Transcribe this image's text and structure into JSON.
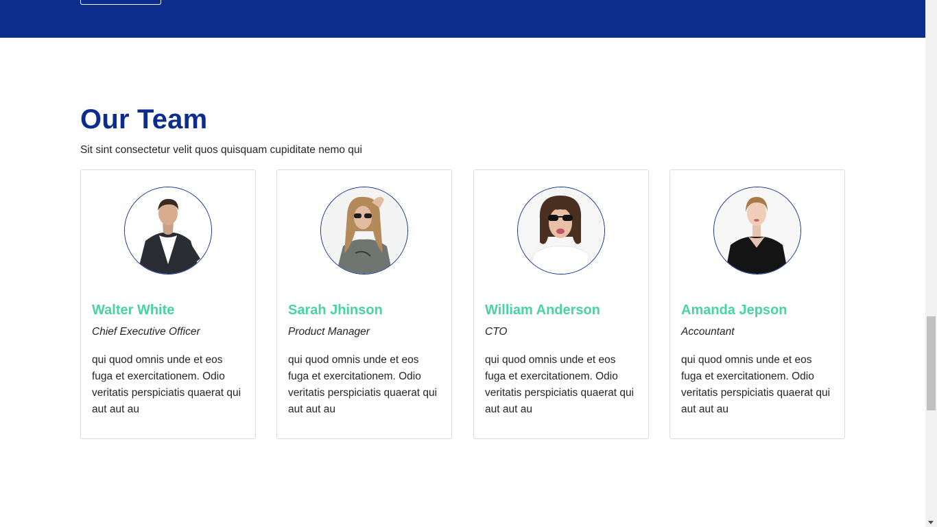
{
  "colors": {
    "brand_blue": "#0c2d8c",
    "name_green": "#47d4a0",
    "card_border": "#dcdcdc"
  },
  "section": {
    "title": "Our Team",
    "subtitle": "Sit sint consectetur velit quos quisquam cupiditate nemo qui"
  },
  "team": [
    {
      "name": "Walter White",
      "role": "Chief Executive Officer",
      "bio": "qui quod omnis unde et eos fuga et exercitationem. Odio veritatis perspiciatis quaerat qui aut aut au",
      "photo_icon": "man-in-suit-photo"
    },
    {
      "name": "Sarah Jhinson",
      "role": "Product Manager",
      "bio": "qui quod omnis unde et eos fuga et exercitationem. Odio veritatis perspiciatis quaerat qui aut aut au",
      "photo_icon": "woman-with-sunglasses-photo"
    },
    {
      "name": "William Anderson",
      "role": "CTO",
      "bio": "qui quod omnis unde et eos fuga et exercitationem. Odio veritatis perspiciatis quaerat qui aut aut au",
      "photo_icon": "man-with-sunglasses-photo"
    },
    {
      "name": "Amanda Jepson",
      "role": "Accountant",
      "bio": "qui quod omnis unde et eos fuga et exercitationem. Odio veritatis perspiciatis quaerat qui aut aut au",
      "photo_icon": "woman-in-black-top-photo"
    }
  ]
}
